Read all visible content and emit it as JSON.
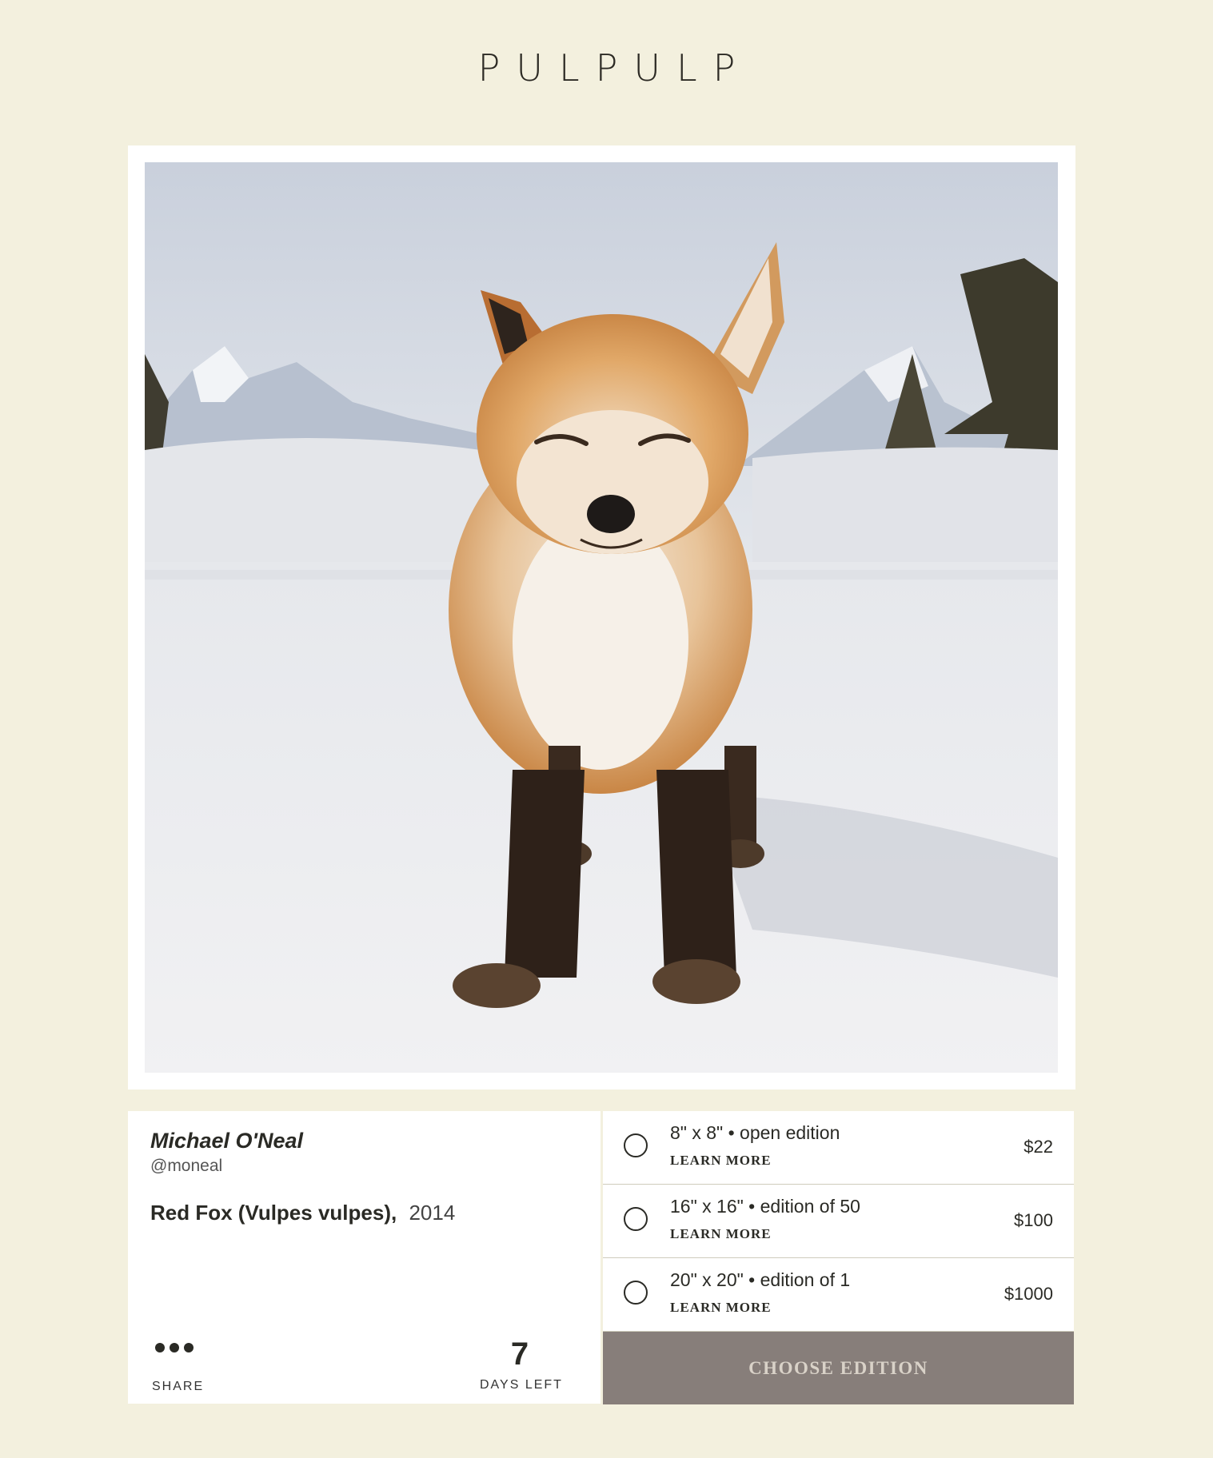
{
  "brand": {
    "logo": "PULPULP"
  },
  "artwork": {
    "image_description": "fox-photo",
    "artist_name": "Michael O'Neal",
    "artist_handle": "@moneal",
    "title": "Red Fox (Vulpes vulpes),",
    "year": "2014"
  },
  "share": {
    "label": "SHARE",
    "icon": "more-dots-icon"
  },
  "countdown": {
    "value": "7",
    "label": "DAYS LEFT"
  },
  "editions": [
    {
      "description": "8\" x 8\" • open edition",
      "learn_more": "LEARN MORE",
      "price": "$22"
    },
    {
      "description": "16\" x 16\" • edition of 50",
      "learn_more": "LEARN MORE",
      "price": "$100"
    },
    {
      "description": "20\" x 20\" • edition of 1",
      "learn_more": "LEARN MORE",
      "price": "$1000"
    }
  ],
  "cta": {
    "label": "CHOOSE EDITION"
  },
  "colors": {
    "background": "#f3f0de",
    "card": "#ffffff",
    "button": "#877e7a",
    "button_text": "#d9d2c8",
    "text": "#2a2a25"
  }
}
